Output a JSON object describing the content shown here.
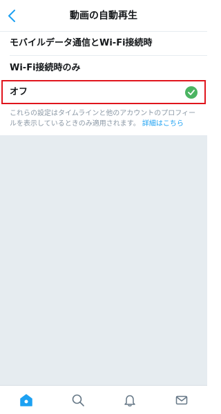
{
  "header": {
    "title": "動画の自動再生",
    "back_icon": "chevron-left-icon"
  },
  "options": [
    {
      "label": "モバイルデータ通信とWi-Fi接続時",
      "selected": false
    },
    {
      "label": "Wi-Fi接続時のみ",
      "selected": false
    },
    {
      "label": "オフ",
      "selected": true
    }
  ],
  "note": {
    "text": "これらの設定はタイムラインと他のアカウントのプロフィールを表示しているときのみ適用されます。",
    "link": "詳細はこちら"
  },
  "tabbar": {
    "tabs": [
      {
        "name": "home",
        "icon": "home-icon",
        "active": true
      },
      {
        "name": "search",
        "icon": "search-icon",
        "active": false
      },
      {
        "name": "notifications",
        "icon": "bell-icon",
        "active": false
      },
      {
        "name": "messages",
        "icon": "mail-icon",
        "active": false
      }
    ]
  },
  "colors": {
    "accent": "#1da1f2",
    "check": "#4bb462",
    "highlight_border": "#e0141c",
    "background_gray": "#e6ecf0"
  }
}
